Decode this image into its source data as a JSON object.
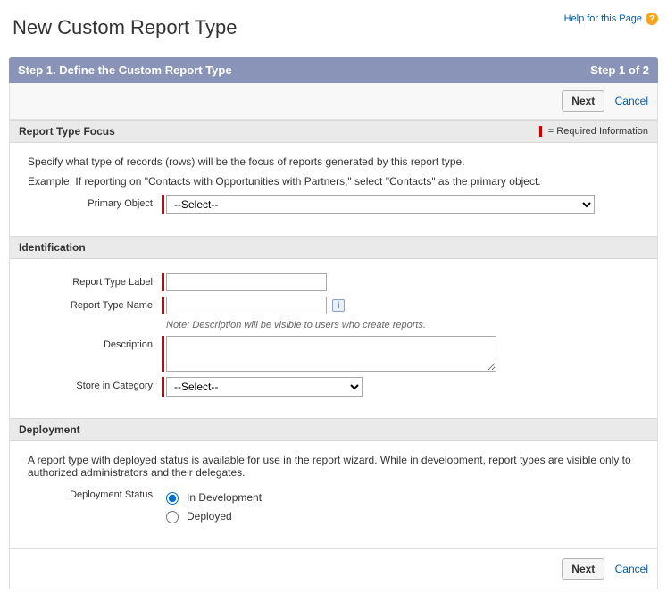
{
  "header": {
    "title": "New Custom Report Type",
    "help_link": "Help for this Page"
  },
  "step_bar": {
    "left": "Step 1. Define the Custom Report Type",
    "right": "Step 1 of 2"
  },
  "buttons": {
    "next": "Next",
    "cancel": "Cancel"
  },
  "required_legend": "= Required Information",
  "focus": {
    "header": "Report Type Focus",
    "line1": "Specify what type of records (rows) will be the focus of reports generated by this report type.",
    "line2": "Example: If reporting on \"Contacts with Opportunities with Partners,\" select \"Contacts\" as the primary object.",
    "primary_object_label": "Primary Object",
    "primary_object_placeholder": "--Select--"
  },
  "identification": {
    "header": "Identification",
    "label_label": "Report Type Label",
    "name_label": "Report Type Name",
    "note": "Note: Description will be visible to users who create reports.",
    "description_label": "Description",
    "category_label": "Store in Category",
    "category_placeholder": "--Select--"
  },
  "deployment": {
    "header": "Deployment",
    "description": "A report type with deployed status is available for use in the report wizard. While in development, report types are visible only to authorized administrators and their delegates.",
    "status_label": "Deployment Status",
    "options": {
      "in_dev": "In Development",
      "deployed": "Deployed"
    }
  }
}
